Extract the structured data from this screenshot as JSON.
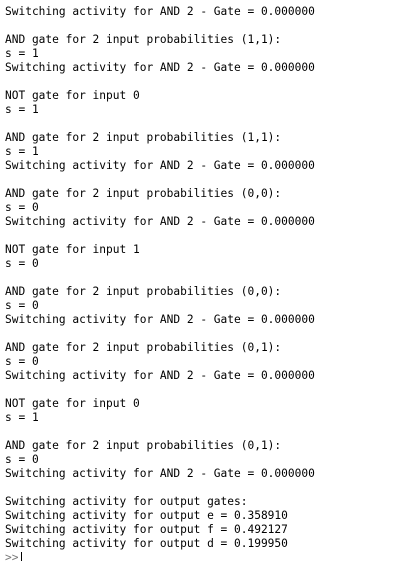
{
  "console": {
    "lines": [
      "Switching activity for AND 2 - Gate = 0.000000",
      "",
      "AND gate for 2 input probabilities (1,1):",
      "s = 1",
      "Switching activity for AND 2 - Gate = 0.000000",
      "",
      "NOT gate for input 0",
      "s = 1",
      "",
      "AND gate for 2 input probabilities (1,1):",
      "s = 1",
      "Switching activity for AND 2 - Gate = 0.000000",
      "",
      "AND gate for 2 input probabilities (0,0):",
      "s = 0",
      "Switching activity for AND 2 - Gate = 0.000000",
      "",
      "NOT gate for input 1",
      "s = 0",
      "",
      "AND gate for 2 input probabilities (0,0):",
      "s = 0",
      "Switching activity for AND 2 - Gate = 0.000000",
      "",
      "AND gate for 2 input probabilities (0,1):",
      "s = 0",
      "Switching activity for AND 2 - Gate = 0.000000",
      "",
      "NOT gate for input 0",
      "s = 1",
      "",
      "AND gate for 2 input probabilities (0,1):",
      "s = 0",
      "Switching activity for AND 2 - Gate = 0.000000",
      "",
      "Switching activity for output gates:",
      "Switching activity for output e = 0.358910",
      "Switching activity for output f = 0.492127",
      "Switching activity for output d = 0.199950"
    ],
    "prompt": ">>"
  }
}
